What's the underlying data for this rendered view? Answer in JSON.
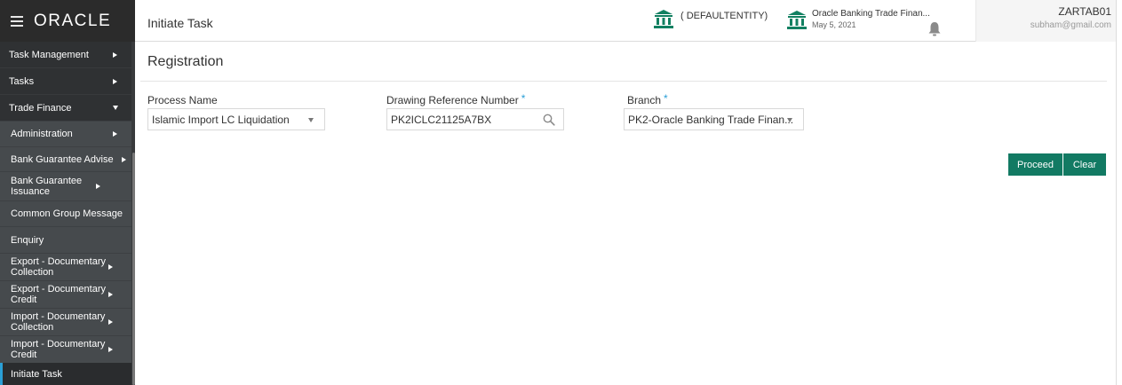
{
  "header": {
    "logo": "ORACLE",
    "page_title": "Initiate Task",
    "entity": "( DEFAULTENTITY)",
    "branch_name": "Oracle Banking Trade Finan...",
    "branch_date": "May 5, 2021",
    "user_name": "ZARTAB01",
    "user_email": "subham@gmail.com"
  },
  "sidebar": {
    "items": [
      {
        "label": "Task Management",
        "icon": "chevron-right-icon"
      },
      {
        "label": "Tasks",
        "icon": "chevron-right-icon"
      },
      {
        "label": "Trade Finance",
        "icon": "chevron-down-icon"
      },
      {
        "label": "Administration",
        "icon": "chevron-right-icon"
      },
      {
        "label": "Bank Guarantee Advise",
        "icon": "chevron-right-icon"
      },
      {
        "label": "Bank Guarantee Issuance",
        "icon": "chevron-right-icon"
      },
      {
        "label": "Common Group Message",
        "icon": ""
      },
      {
        "label": "Enquiry",
        "icon": ""
      },
      {
        "label": "Export - Documentary Collection",
        "icon": "chevron-right-icon"
      },
      {
        "label": "Export - Documentary Credit",
        "icon": "chevron-right-icon"
      },
      {
        "label": "Import - Documentary Collection",
        "icon": "chevron-right-icon"
      },
      {
        "label": "Import - Documentary Credit",
        "icon": "chevron-right-icon"
      },
      {
        "label": "Initiate Task",
        "icon": ""
      }
    ]
  },
  "main": {
    "section_title": "Registration",
    "process_name": {
      "label": "Process Name",
      "value": "Islamic Import LC Liquidation"
    },
    "drawing_ref": {
      "label": "Drawing Reference Number",
      "required": "*",
      "value": "PK2ICLC21125A7BX"
    },
    "branch": {
      "label": "Branch",
      "required": "*",
      "value": "PK2-Oracle Banking Trade Finan..."
    },
    "proceed_label": "Proceed",
    "clear_label": "Clear"
  },
  "colors": {
    "accent": "#127a63",
    "sidebar_bg": "#383a3c",
    "brand_bg": "#2b2b2b",
    "bank_icon": "#128061",
    "required": "#2a9fd6"
  }
}
